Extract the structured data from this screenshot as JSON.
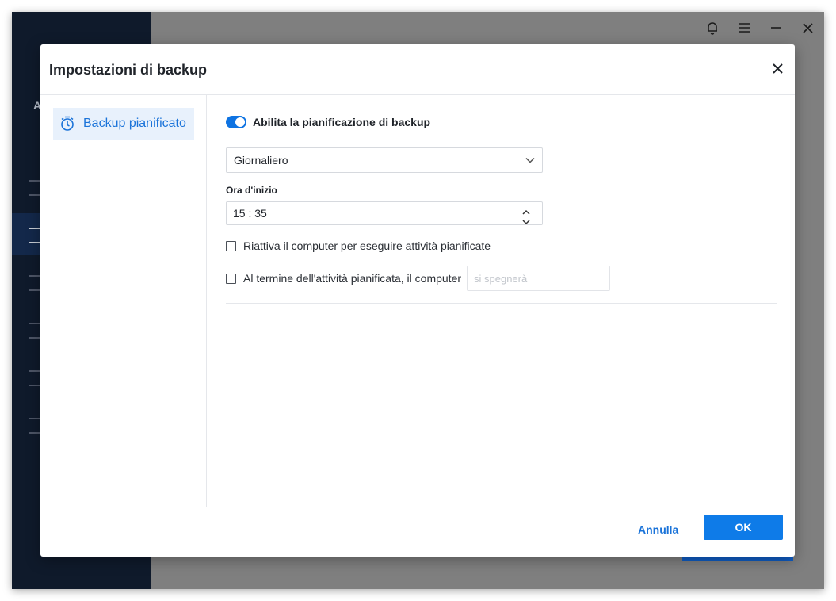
{
  "app": {
    "logo_fragment": "A",
    "titlebar": {
      "bell_icon": "bell-icon",
      "menu_icon": "hamburger-menu-icon",
      "minimize_icon": "minimize-icon",
      "close_icon": "close-icon"
    }
  },
  "dialog": {
    "title": "Impostazioni di backup",
    "close_icon": "close-icon",
    "nav": {
      "items": [
        {
          "label": "Backup pianificato",
          "icon": "timer-icon",
          "selected": true
        }
      ]
    },
    "body": {
      "enable_toggle": {
        "label": "Abilita la pianificazione di backup",
        "on": true
      },
      "frequency": {
        "value": "Giornaliero"
      },
      "start_time": {
        "label": "Ora d'inizio",
        "value": "15 : 35"
      },
      "wake_checkbox": {
        "label": "Riattiva il computer per eseguire attività pianificate",
        "checked": false
      },
      "after_task_checkbox": {
        "label": "Al termine dell'attività pianificata, il computer",
        "checked": false
      },
      "after_task_input": {
        "placeholder": "si spegnerà"
      }
    },
    "footer": {
      "cancel_label": "Annulla",
      "ok_label": "OK"
    }
  },
  "colors": {
    "accent": "#0e7be8",
    "sidebar_dark": "#0f1a2b",
    "overlay_gray": "#7f7f7f"
  }
}
